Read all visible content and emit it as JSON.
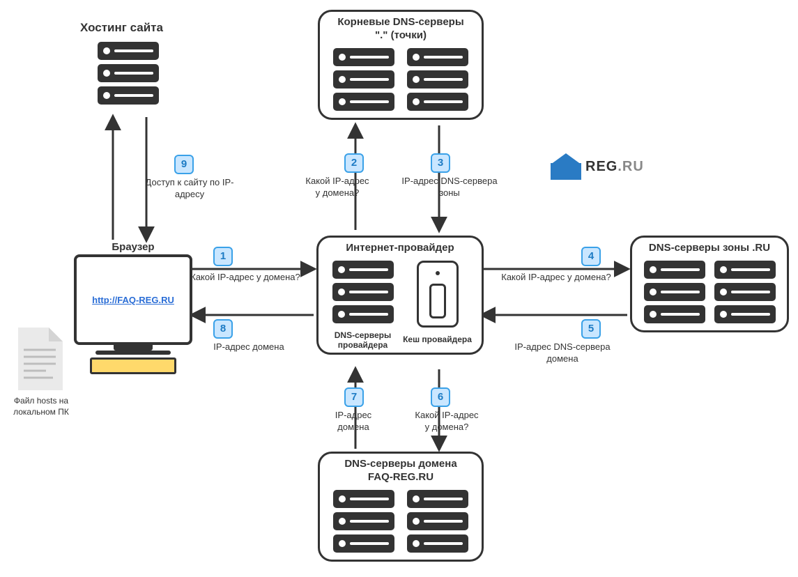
{
  "hosting": {
    "title": "Хостинг сайта"
  },
  "root": {
    "title_l1": "Корневые DNS-серверы",
    "title_l2": "\".\" (точки)"
  },
  "zone": {
    "title": "DNS-серверы зоны .RU"
  },
  "domain_srv": {
    "title_l1": "DNS-серверы домена",
    "title_l2": "FAQ-REG.RU"
  },
  "isp": {
    "title": "Интернет-провайдер",
    "sub_left": "DNS-серверы провайдера",
    "sub_right": "Кеш провайдера"
  },
  "browser": {
    "title": "Браузер",
    "url": "http://FAQ-REG.RU"
  },
  "hosts": {
    "l1": "Файл hosts на",
    "l2": "локальном ПК"
  },
  "brand": {
    "main": "REG",
    "suffix": ".RU"
  },
  "steps": {
    "1": {
      "num": "1",
      "text": "Какой IP-адрес у домена?"
    },
    "2": {
      "num": "2",
      "text_l1": "Какой IP-адрес",
      "text_l2": "у домена?"
    },
    "3": {
      "num": "3",
      "text_l1": "IP-адрес DNS-сервера",
      "text_l2": "зоны"
    },
    "4": {
      "num": "4",
      "text": "Какой IP-адрес у домена?"
    },
    "5": {
      "num": "5",
      "text_l1": "IP-адрес DNS-сервера",
      "text_l2": "домена"
    },
    "6": {
      "num": "6",
      "text_l1": "Какой IP-адрес",
      "text_l2": "у домена?"
    },
    "7": {
      "num": "7",
      "text_l1": "IP-адрес",
      "text_l2": "домена"
    },
    "8": {
      "num": "8",
      "text": "IP-адрес домена"
    },
    "9": {
      "num": "9",
      "text_l1": "Доступ к сайту по IP-",
      "text_l2": "адресу"
    }
  }
}
